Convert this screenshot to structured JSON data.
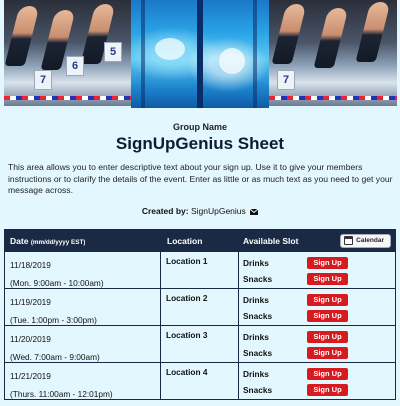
{
  "banner": {
    "left_block_numbers": [
      "7",
      "6",
      "5"
    ],
    "right_block_numbers": [
      "7"
    ]
  },
  "header": {
    "group_name": "Group Name",
    "title": "SignUpGenius Sheet",
    "description": "This area allows you to enter descriptive text about your sign up. Use it to give your members instructions or to clarify the details of the event. Enter as little or as much text as you need to get your message across.",
    "created_by_label": "Created by:",
    "created_by_name": "SignUpGenius"
  },
  "table": {
    "columns": {
      "date": "Date",
      "date_format": "(mm/dd/yyyy EST)",
      "location": "Location",
      "slot": "Available Slot",
      "calendar_button": "Calendar"
    },
    "rows": [
      {
        "date": "11/18/2019",
        "time": "(Mon. 9:00am - 10:00am)",
        "location": "Location 1",
        "slots": [
          {
            "name": "Drinks",
            "button": "Sign Up"
          },
          {
            "name": "Snacks",
            "button": "Sign Up"
          }
        ]
      },
      {
        "date": "11/19/2019",
        "time": "(Tue. 1:00pm - 3:00pm)",
        "location": "Location 2",
        "slots": [
          {
            "name": "Drinks",
            "button": "Sign Up"
          },
          {
            "name": "Snacks",
            "button": "Sign Up"
          }
        ]
      },
      {
        "date": "11/20/2019",
        "time": "(Wed. 7:00am - 9:00am)",
        "location": "Location 3",
        "slots": [
          {
            "name": "Drinks",
            "button": "Sign Up"
          },
          {
            "name": "Snacks",
            "button": "Sign Up"
          }
        ]
      },
      {
        "date": "11/21/2019",
        "time": "(Thurs. 11:00am - 12:01pm)",
        "location": "Location 4",
        "slots": [
          {
            "name": "Drinks",
            "button": "Sign Up"
          },
          {
            "name": "Snacks",
            "button": "Sign Up"
          }
        ]
      }
    ]
  },
  "colors": {
    "background": "#e3f8fe",
    "header_bar": "#1b2a44",
    "signup_button": "#d71920",
    "title": "#0d1b33"
  },
  "icons": [
    "mail-icon",
    "calendar-icon"
  ]
}
